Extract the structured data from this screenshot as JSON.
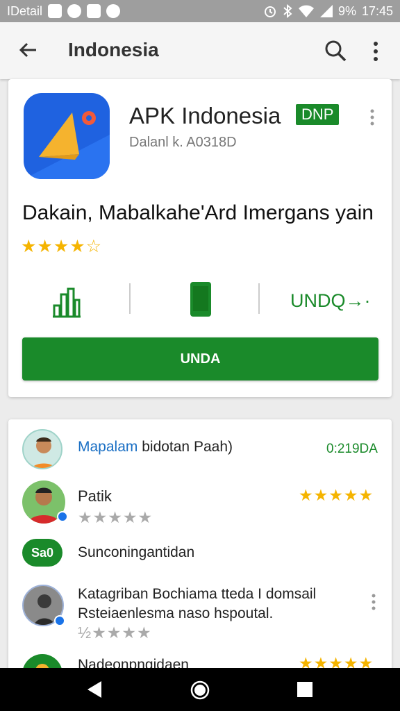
{
  "status_bar": {
    "left_text": "IDetail",
    "battery": "9%",
    "time": "17:45",
    "icons": [
      "notification-icon",
      "notification-icon",
      "notification-icon",
      "notification-icon",
      "alarm-icon",
      "bluetooth-icon",
      "wifi-icon",
      "signal-icon"
    ]
  },
  "app_bar": {
    "title": "Indonesia",
    "icons": [
      "back-arrow-icon",
      "search-icon",
      "more-vert-icon"
    ]
  },
  "app_card": {
    "name": "APK Indonesia",
    "badge": "DNP",
    "developer": "Dalanl k. A0318D",
    "tagline": "Dakain, Mabalkahe'Ard Imergans yain",
    "rating_stars": 4,
    "rating_max": 5,
    "action_link": "UNDQ→·",
    "install_label": "UNDA",
    "icon_colors": {
      "background": "#1f62e0",
      "triangle": "#f5b32e",
      "dot": "#f05a3a"
    }
  },
  "reviews": [
    {
      "text": "Mapalam bidotan Paah)",
      "highlight": "Mapalam",
      "meta": "0:219DA"
    },
    {
      "name": "Patik",
      "user_stars": 5,
      "grey_stars": 5
    },
    {
      "pill": "Sa0",
      "text": "Sunconingantidan"
    },
    {
      "line1": "Katagriban Bochiama tteda I domsail",
      "line2": "Rsteiaenlesma naso hspoutal.",
      "grey_stars": 4,
      "prefix": "½"
    },
    {
      "text": "Nadeonpngidaen"
    }
  ],
  "colors": {
    "accent": "#1a8a2a",
    "star": "#f5b400",
    "status_bar": "#9e9e9e"
  }
}
